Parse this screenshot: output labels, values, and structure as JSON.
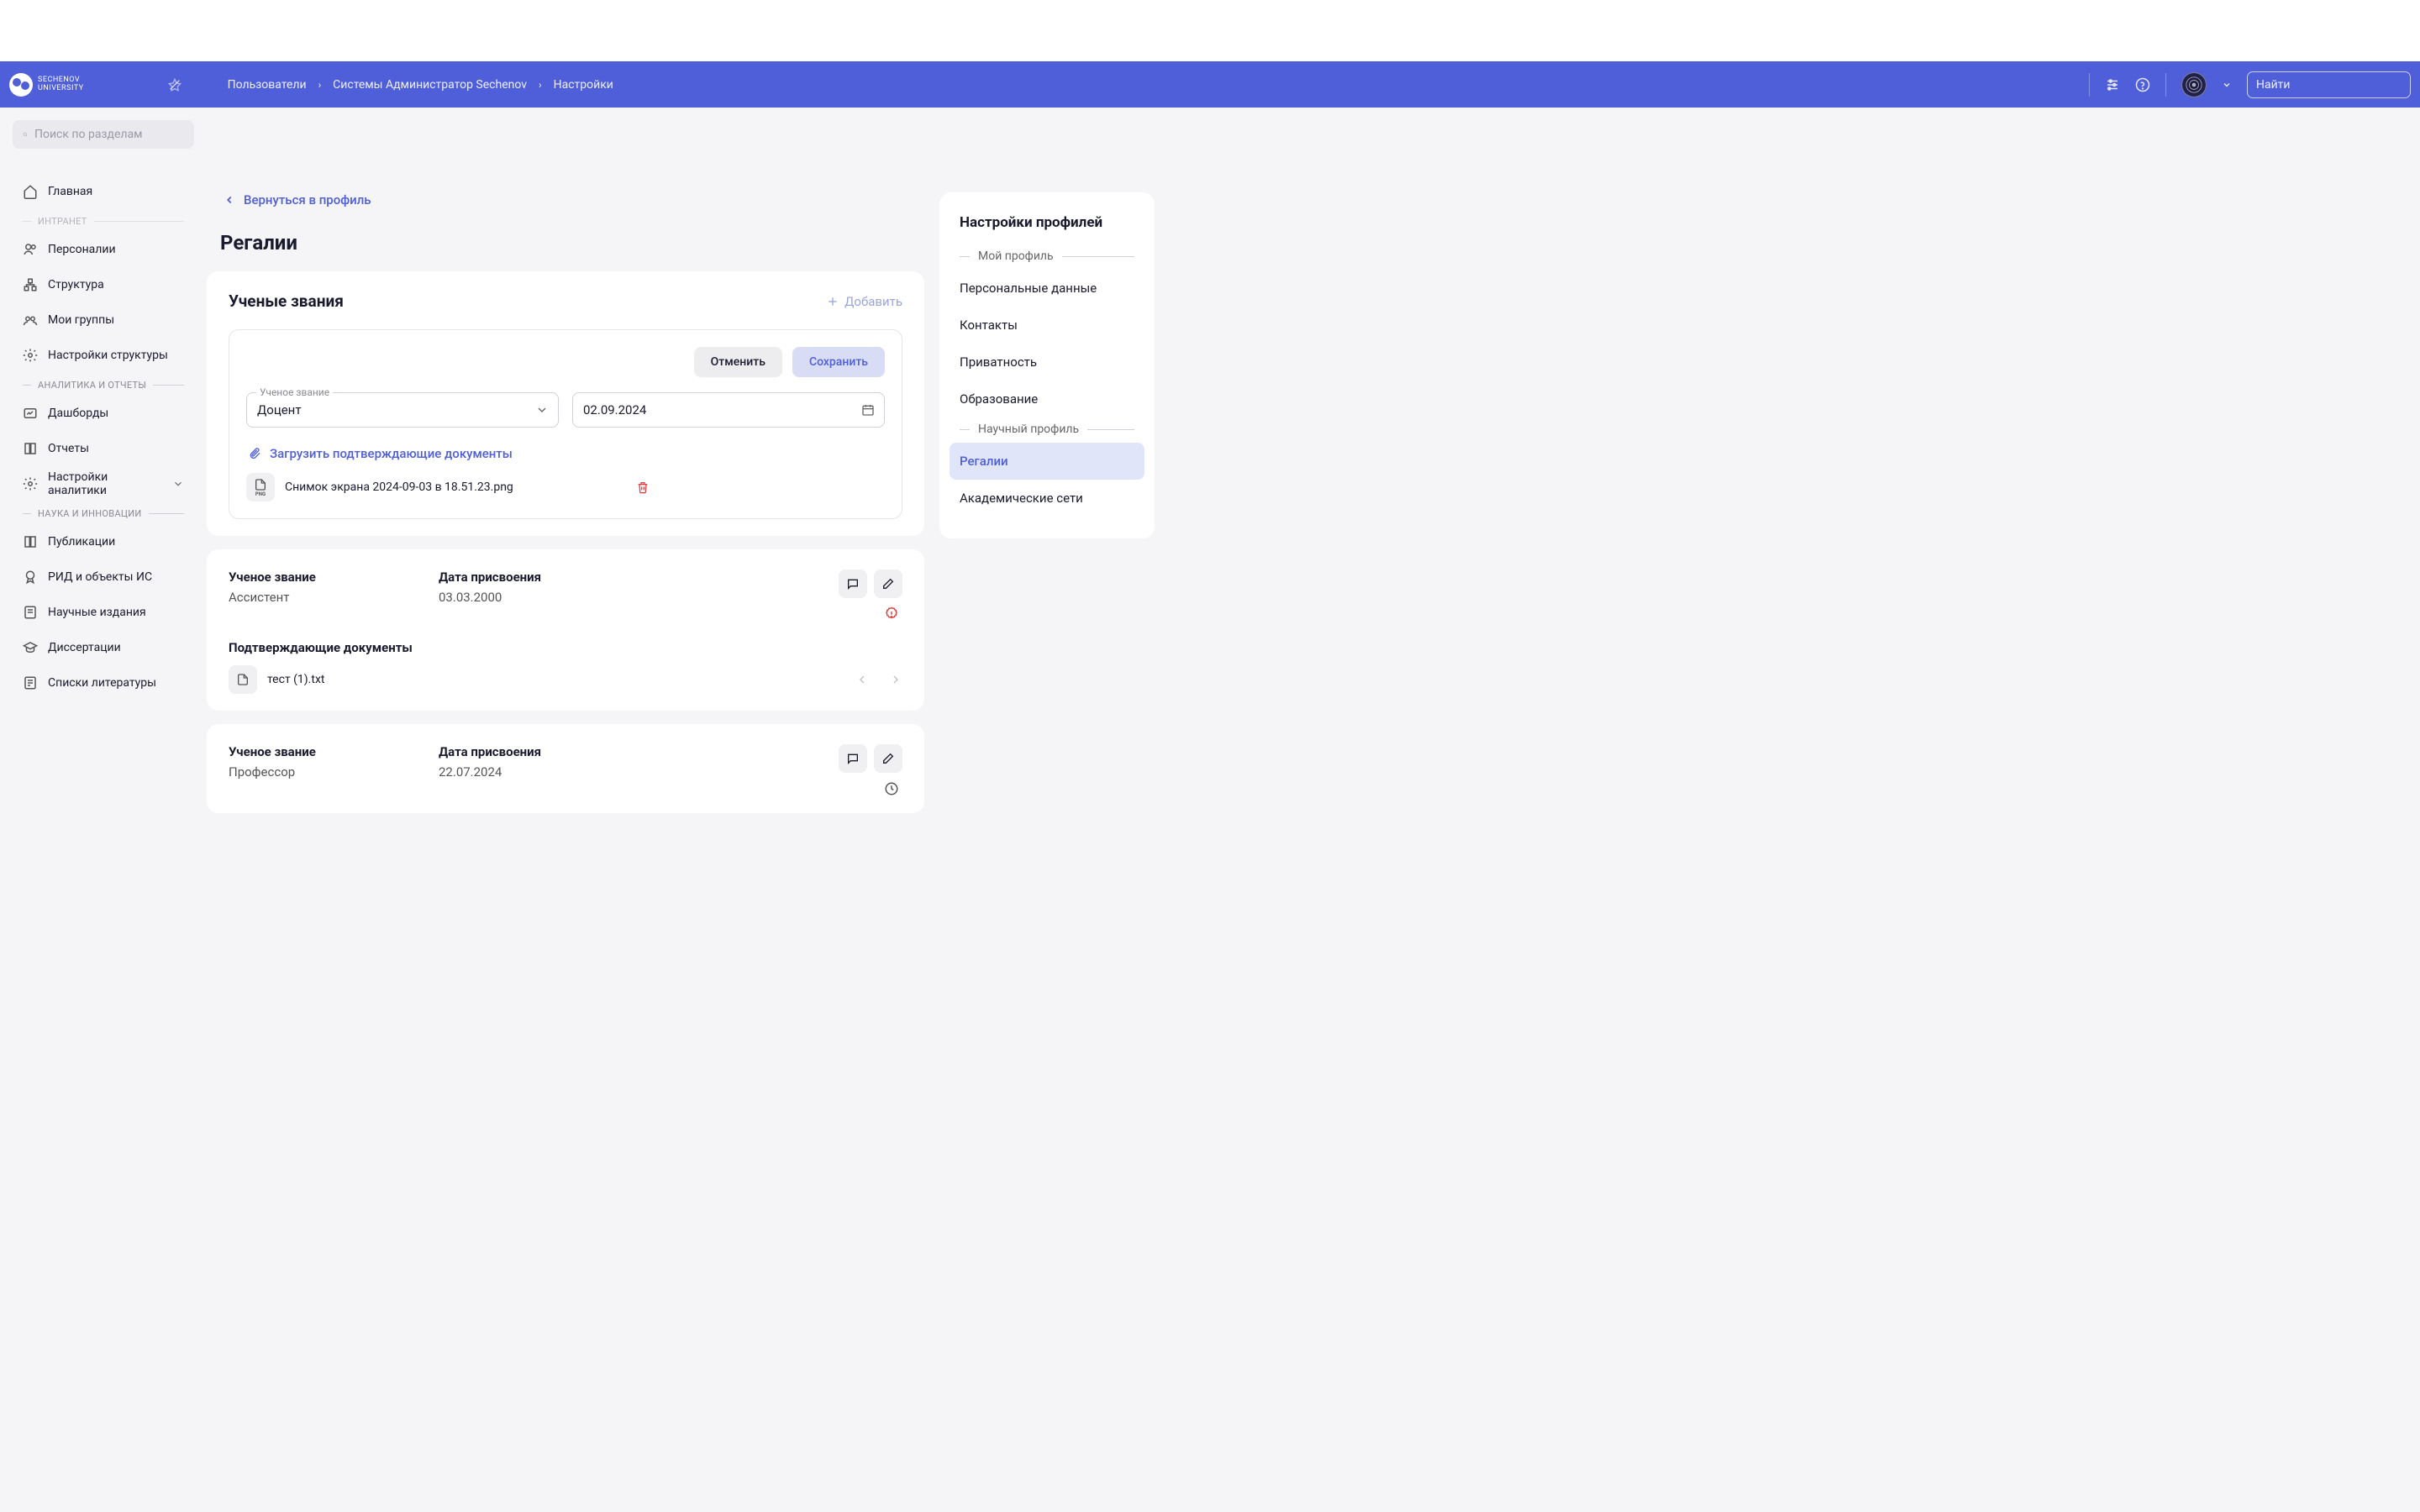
{
  "logo": {
    "line1": "Sechenov",
    "line2": "University"
  },
  "breadcrumb": [
    "Пользователи",
    "Системы Администратор Sechenov",
    "Настройки"
  ],
  "search": {
    "placeholder": "Найти"
  },
  "sidebar": {
    "search_placeholder": "Поиск по разделам",
    "items_top": [
      {
        "icon": "home",
        "label": "Главная"
      }
    ],
    "section1": "ИНТРАНЕТ",
    "items1": [
      {
        "icon": "users",
        "label": "Персоналии"
      },
      {
        "icon": "org",
        "label": "Структура"
      },
      {
        "icon": "group",
        "label": "Мои группы"
      },
      {
        "icon": "gear",
        "label": "Настройки структуры"
      }
    ],
    "section2": "АНАЛИТИКА И ОТЧЕТЫ",
    "items2": [
      {
        "icon": "dashboard",
        "label": "Дашборды"
      },
      {
        "icon": "book",
        "label": "Отчеты"
      },
      {
        "icon": "gear",
        "label": "Настройки аналитики",
        "chevron": true
      }
    ],
    "section3": "НАУКА И ИННОВАЦИИ",
    "items3": [
      {
        "icon": "pub",
        "label": "Публикации"
      },
      {
        "icon": "medal",
        "label": "РИД и объекты ИС"
      },
      {
        "icon": "journal",
        "label": "Научные издания"
      },
      {
        "icon": "cap",
        "label": "Диссертации"
      },
      {
        "icon": "list",
        "label": "Списки литературы"
      }
    ]
  },
  "back_link": "Вернуться в профиль",
  "page_title": "Регалии",
  "titles_card": {
    "title": "Ученые звания",
    "add": "Добавить",
    "cancel": "Отменить",
    "save": "Сохранить",
    "field_label": "Ученое звание",
    "field_value": "Доцент",
    "date_value": "02.09.2024",
    "upload": "Загрузить подтверждающие документы",
    "file_name": "Снимок экрана 2024-09-03 в 18.51.23.png"
  },
  "records": [
    {
      "title_label": "Ученое звание",
      "title_value": "Ассистент",
      "date_label": "Дата присвоения",
      "date_value": "03.03.2000",
      "docs_label": "Подтверждающие документы",
      "file_name": "тест (1).txt"
    },
    {
      "title_label": "Ученое звание",
      "title_value": "Профессор",
      "date_label": "Дата присвоения",
      "date_value": "22.07.2024"
    }
  ],
  "panel": {
    "title": "Настройки профилей",
    "section1": "Мой профиль",
    "items1": [
      "Персональные данные",
      "Контакты",
      "Приватность",
      "Образование"
    ],
    "section2": "Научный профиль",
    "items2": [
      "Регалии",
      "Академические сети"
    ],
    "active": "Регалии"
  }
}
